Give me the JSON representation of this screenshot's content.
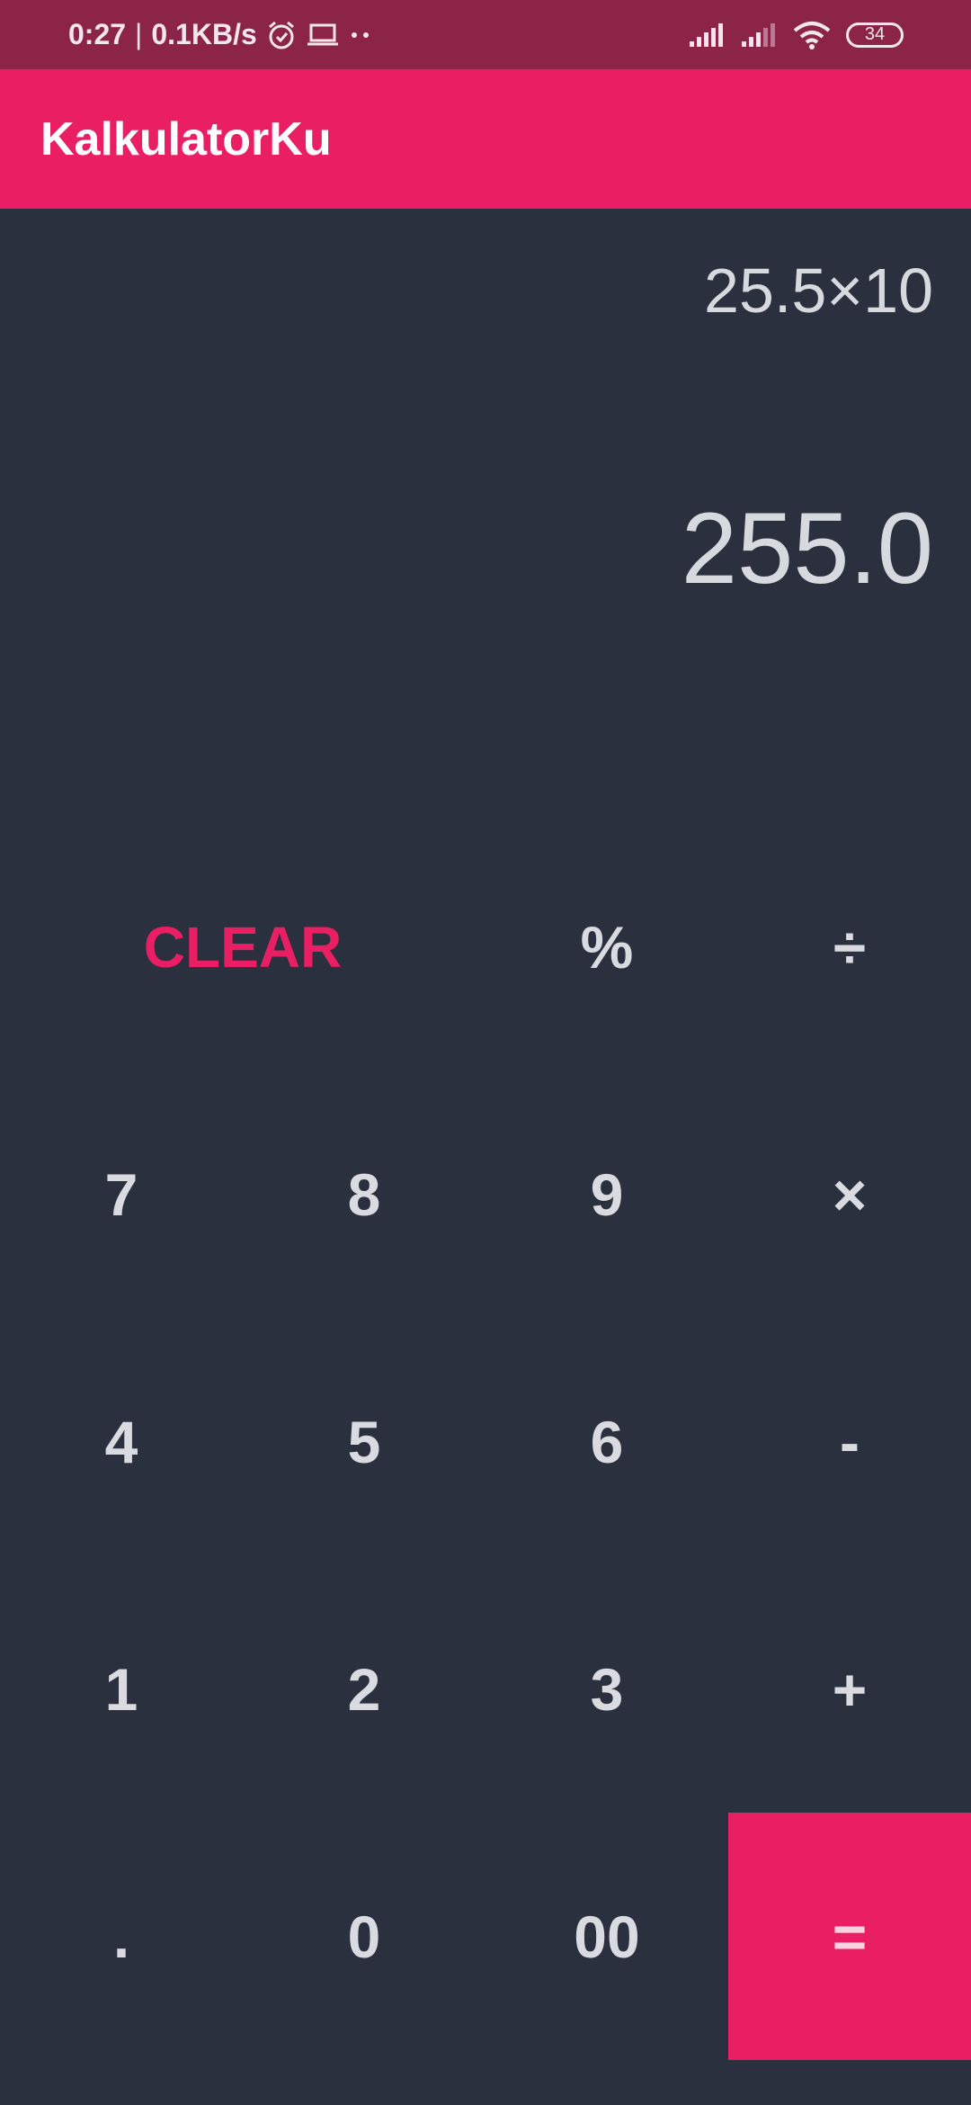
{
  "status_bar": {
    "time": "0:27",
    "separator": "|",
    "net_speed": "0.1KB/s",
    "icons": [
      "alarm-icon",
      "laptop-icon",
      "dots-icon",
      "signal-icon",
      "signal-weak-icon",
      "wifi-icon"
    ],
    "battery": "34"
  },
  "app_bar": {
    "title": "KalkulatorKu"
  },
  "display": {
    "expression": "25.5×10",
    "result": "255.0"
  },
  "keypad": {
    "clear": "CLEAR",
    "percent": "%",
    "divide": "÷",
    "seven": "7",
    "eight": "8",
    "nine": "9",
    "multiply": "×",
    "four": "4",
    "five": "5",
    "six": "6",
    "minus": "-",
    "one": "1",
    "two": "2",
    "three": "3",
    "plus": "+",
    "dot": ".",
    "zero": "0",
    "double_zero": "00",
    "equals": "="
  },
  "colors": {
    "accent": "#e91e63",
    "status_bar": "#8c2447",
    "background": "#2b303e",
    "text": "#d9dbe0"
  }
}
